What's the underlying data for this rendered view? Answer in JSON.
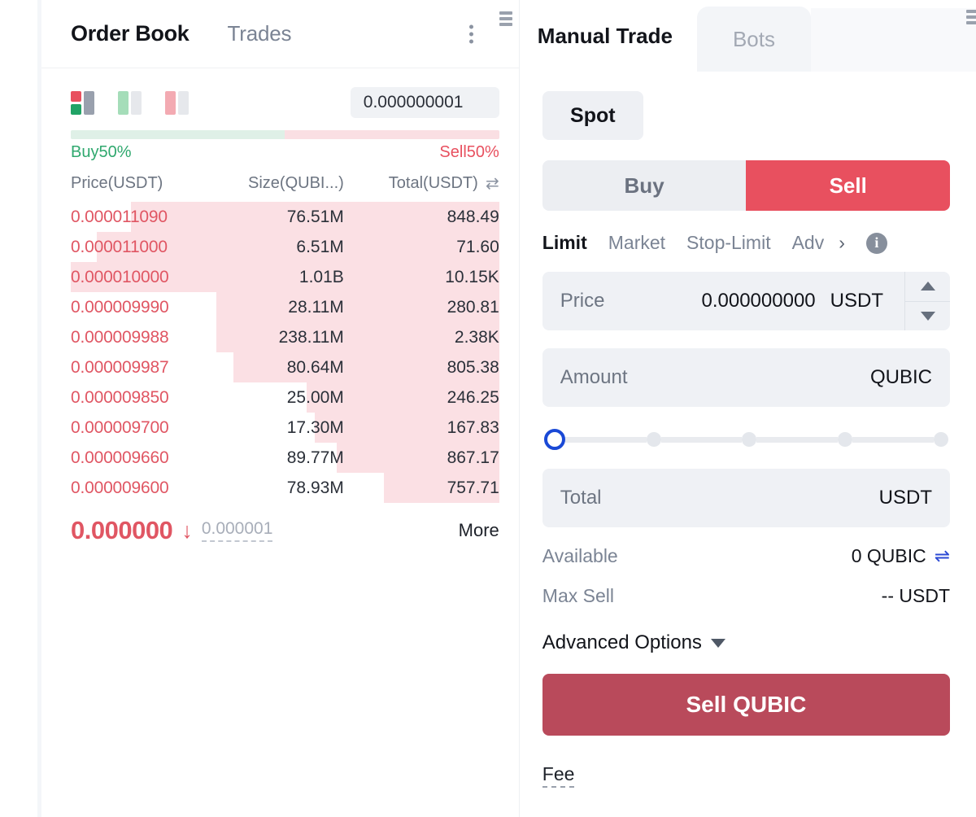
{
  "order_book": {
    "tabs": [
      {
        "label": "Order Book",
        "active": true
      },
      {
        "label": "Trades",
        "active": false
      }
    ],
    "menu_icon": "kebab-menu-icon",
    "grip_icon": "drag-handle-icon",
    "view_modes": [
      "both-depth-icon",
      "buy-depth-icon",
      "sell-depth-icon"
    ],
    "decimal_select": {
      "value": "0.000000001",
      "caret": "chevron-down-icon"
    },
    "ratio": {
      "buy_label": "Buy50%",
      "sell_label": "Sell50%",
      "buy_percent": 50,
      "sell_percent": 50
    },
    "columns": {
      "price": "Price(USDT)",
      "size": "Size(QUBI...)",
      "total": "Total(USDT)",
      "swap_icon": "swap-arrows-icon"
    },
    "asks": [
      {
        "price": "0.000011090",
        "size": "76.51M",
        "total": "848.49",
        "depth": 86
      },
      {
        "price": "0.000011000",
        "size": "6.51M",
        "total": "71.60",
        "depth": 94
      },
      {
        "price": "0.000010000",
        "size": "1.01B",
        "total": "10.15K",
        "depth": 100
      },
      {
        "price": "0.000009990",
        "size": "28.11M",
        "total": "280.81",
        "depth": 66
      },
      {
        "price": "0.000009988",
        "size": "238.11M",
        "total": "2.38K",
        "depth": 66
      },
      {
        "price": "0.000009987",
        "size": "80.64M",
        "total": "805.38",
        "depth": 62
      },
      {
        "price": "0.000009850",
        "size": "25.00M",
        "total": "246.25",
        "depth": 45
      },
      {
        "price": "0.000009700",
        "size": "17.30M",
        "total": "167.83",
        "depth": 43
      },
      {
        "price": "0.000009660",
        "size": "89.77M",
        "total": "867.17",
        "depth": 38
      },
      {
        "price": "0.000009600",
        "size": "78.93M",
        "total": "757.71",
        "depth": 27
      }
    ],
    "last_price": {
      "value": "0.000000",
      "direction_icon": "arrow-down-icon",
      "secondary": "0.000001",
      "more_label": "More"
    }
  },
  "trade_panel": {
    "tabs": [
      {
        "label": "Manual Trade",
        "active": true
      },
      {
        "label": "Bots",
        "active": false
      }
    ],
    "grip_icon": "drag-handle-icon",
    "market_type": "Spot",
    "side": {
      "buy_label": "Buy",
      "sell_label": "Sell",
      "active": "Sell"
    },
    "order_types": [
      {
        "label": "Limit",
        "active": true
      },
      {
        "label": "Market",
        "active": false
      },
      {
        "label": "Stop-Limit",
        "active": false
      },
      {
        "label": "Adv",
        "active": false
      }
    ],
    "order_types_chevron": "chevron-right-icon",
    "info_icon": "info-icon",
    "price_field": {
      "label": "Price",
      "value": "0.000000000",
      "unit": "USDT",
      "stepper_up": "stepper-up-icon",
      "stepper_down": "stepper-down-icon"
    },
    "amount_field": {
      "label": "Amount",
      "value": "",
      "unit": "QUBIC"
    },
    "slider": {
      "value": 0,
      "stops": [
        0,
        25,
        50,
        75,
        100
      ]
    },
    "total_field": {
      "label": "Total",
      "value": "",
      "unit": "USDT"
    },
    "available": {
      "label": "Available",
      "value": "0 QUBIC",
      "transfer_icon": "transfer-arrows-icon"
    },
    "max_sell": {
      "label": "Max Sell",
      "value": "-- USDT"
    },
    "advanced_options": {
      "label": "Advanced Options",
      "caret": "chevron-down-icon"
    },
    "submit_button": "Sell QUBIC",
    "fee_label": "Fee"
  },
  "colors": {
    "sell_red": "#e8505f",
    "submit_red": "#b94a5b",
    "buy_green": "#2fa86e",
    "accent_blue": "#1a49d6"
  }
}
